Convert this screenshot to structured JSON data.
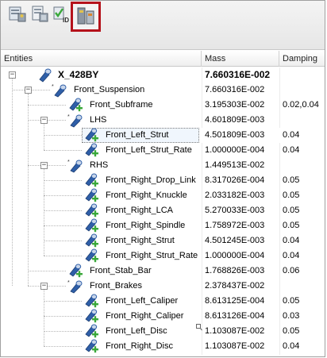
{
  "toolbar": {
    "buttons": [
      {
        "name": "mass-summary-button-1",
        "icon": "component-table-icon"
      },
      {
        "name": "mass-summary-button-2",
        "icon": "component-sheet-icon"
      },
      {
        "name": "mass-summary-button-3",
        "icon": "id-check-icon"
      },
      {
        "name": "mass-summary-button-4",
        "icon": "body-properties-icon",
        "active": true,
        "active_color": "#b5121b"
      }
    ]
  },
  "header": {
    "entities": "Entities",
    "mass": "Mass",
    "damping": "Damping"
  },
  "rows": [
    {
      "label": "X_428BY",
      "mass": "7.660316E-002",
      "damping": "",
      "bold": true
    },
    {
      "label": "Front_Suspension",
      "mass": "7.660316E-002",
      "damping": ""
    },
    {
      "label": "Front_Subframe",
      "mass": "3.195303E-002",
      "damping": "0.02,0.04"
    },
    {
      "label": "LHS",
      "mass": "4.601809E-003",
      "damping": ""
    },
    {
      "label": "Front_Left_Strut",
      "mass": "4.501809E-003",
      "damping": "0.04",
      "selected": true
    },
    {
      "label": "Front_Left_Strut_Rate",
      "mass": "1.000000E-004",
      "damping": "0.04"
    },
    {
      "label": "RHS",
      "mass": "1.449513E-002",
      "damping": ""
    },
    {
      "label": "Front_Right_Drop_Link",
      "mass": "8.317026E-004",
      "damping": "0.05"
    },
    {
      "label": "Front_Right_Knuckle",
      "mass": "2.033182E-003",
      "damping": "0.05"
    },
    {
      "label": "Front_Right_LCA",
      "mass": "5.270033E-003",
      "damping": "0.05"
    },
    {
      "label": "Front_Right_Spindle",
      "mass": "1.758972E-003",
      "damping": "0.05"
    },
    {
      "label": "Front_Right_Strut",
      "mass": "4.501245E-003",
      "damping": "0.04"
    },
    {
      "label": "Front_Right_Strut_Rate",
      "mass": "1.000000E-004",
      "damping": "0.04"
    },
    {
      "label": "Front_Stab_Bar",
      "mass": "1.768826E-003",
      "damping": "0.06"
    },
    {
      "label": "Front_Brakes",
      "mass": "2.378437E-002",
      "damping": ""
    },
    {
      "label": "Front_Left_Caliper",
      "mass": "8.613125E-004",
      "damping": "0.05"
    },
    {
      "label": "Front_Right_Caliper",
      "mass": "8.613126E-004",
      "damping": "0.03"
    },
    {
      "label": "Front_Left_Disc",
      "mass": "1.103087E-002",
      "damping": "0.05"
    },
    {
      "label": "Front_Right_Disc",
      "mass": "1.103087E-002",
      "damping": "0.04"
    }
  ],
  "colors": {
    "selection_fill": "#f0f6fd",
    "active_border": "#b5121b",
    "icon_blue": "#2f5fa8",
    "icon_green": "#3aa83a"
  }
}
